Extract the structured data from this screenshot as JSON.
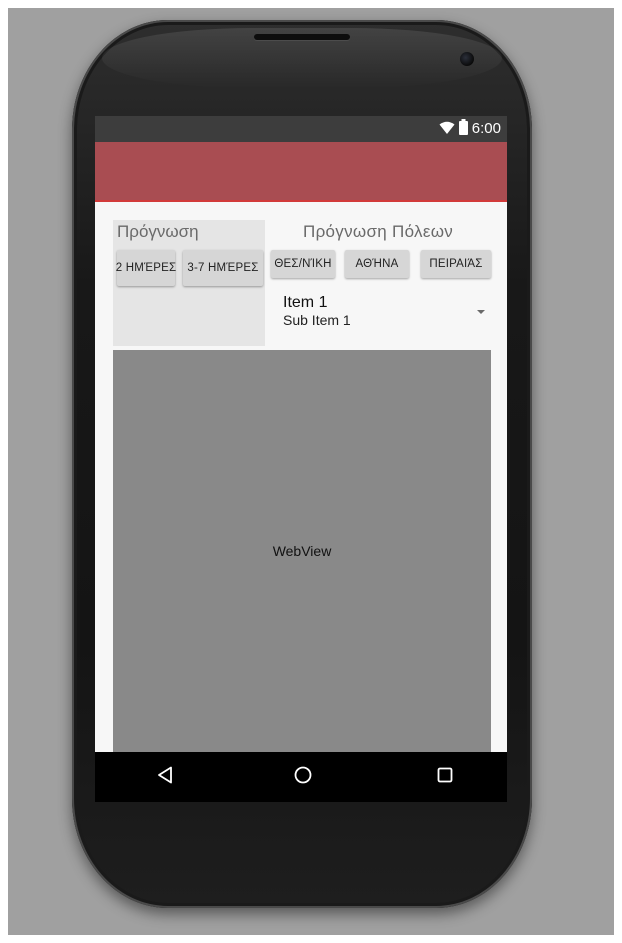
{
  "status_bar": {
    "time": "6:00",
    "wifi_icon": "wifi-icon",
    "battery_icon": "battery-icon"
  },
  "forecast_panel": {
    "title": "Πρόγνωση",
    "buttons": [
      "2 ΗΜΈΡΕΣ",
      "3-7 ΗΜΈΡΕΣ"
    ]
  },
  "cities_panel": {
    "title": "Πρόγνωση Πόλεων",
    "buttons": [
      "ΘΕΣ/ΝΊΚΗ",
      "ΑΘΉΝΑ",
      "ΠΕΙΡΑΙΆΣ"
    ]
  },
  "spinner": {
    "item": "Item 1",
    "sub_item": "Sub Item 1"
  },
  "webview": {
    "label": "WebView"
  },
  "colors": {
    "app_bar": "#a94d52",
    "status_bar": "#3d3d3d",
    "webview": "#898989"
  }
}
